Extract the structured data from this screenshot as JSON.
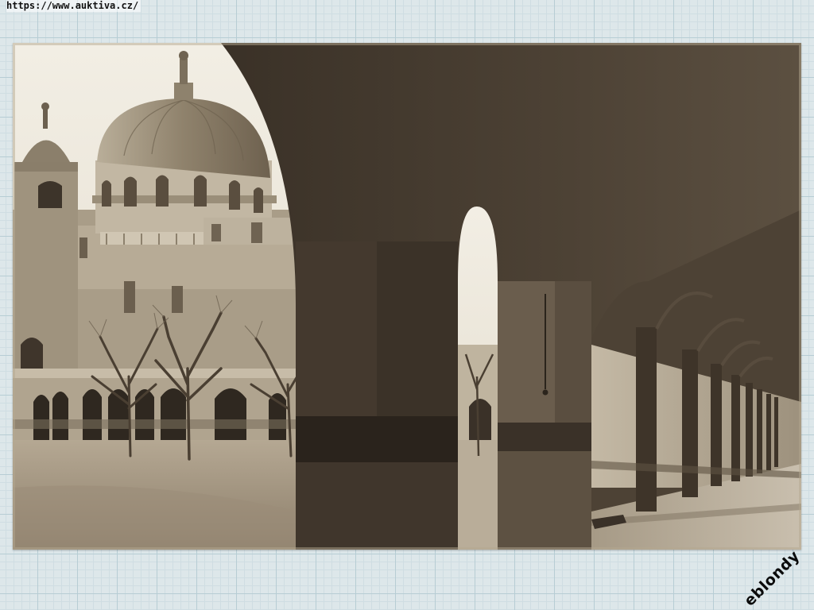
{
  "source_url": "https://www.auktiva.cz/",
  "watermark": "eblondy",
  "photo": {
    "subject": "sepia-postcard-church-dome-and-arcade",
    "tone_dark": "#2e261d",
    "tone_mid": "#6d5e4c",
    "tone_light": "#d9cfbd",
    "sky": "#ece6d8"
  }
}
